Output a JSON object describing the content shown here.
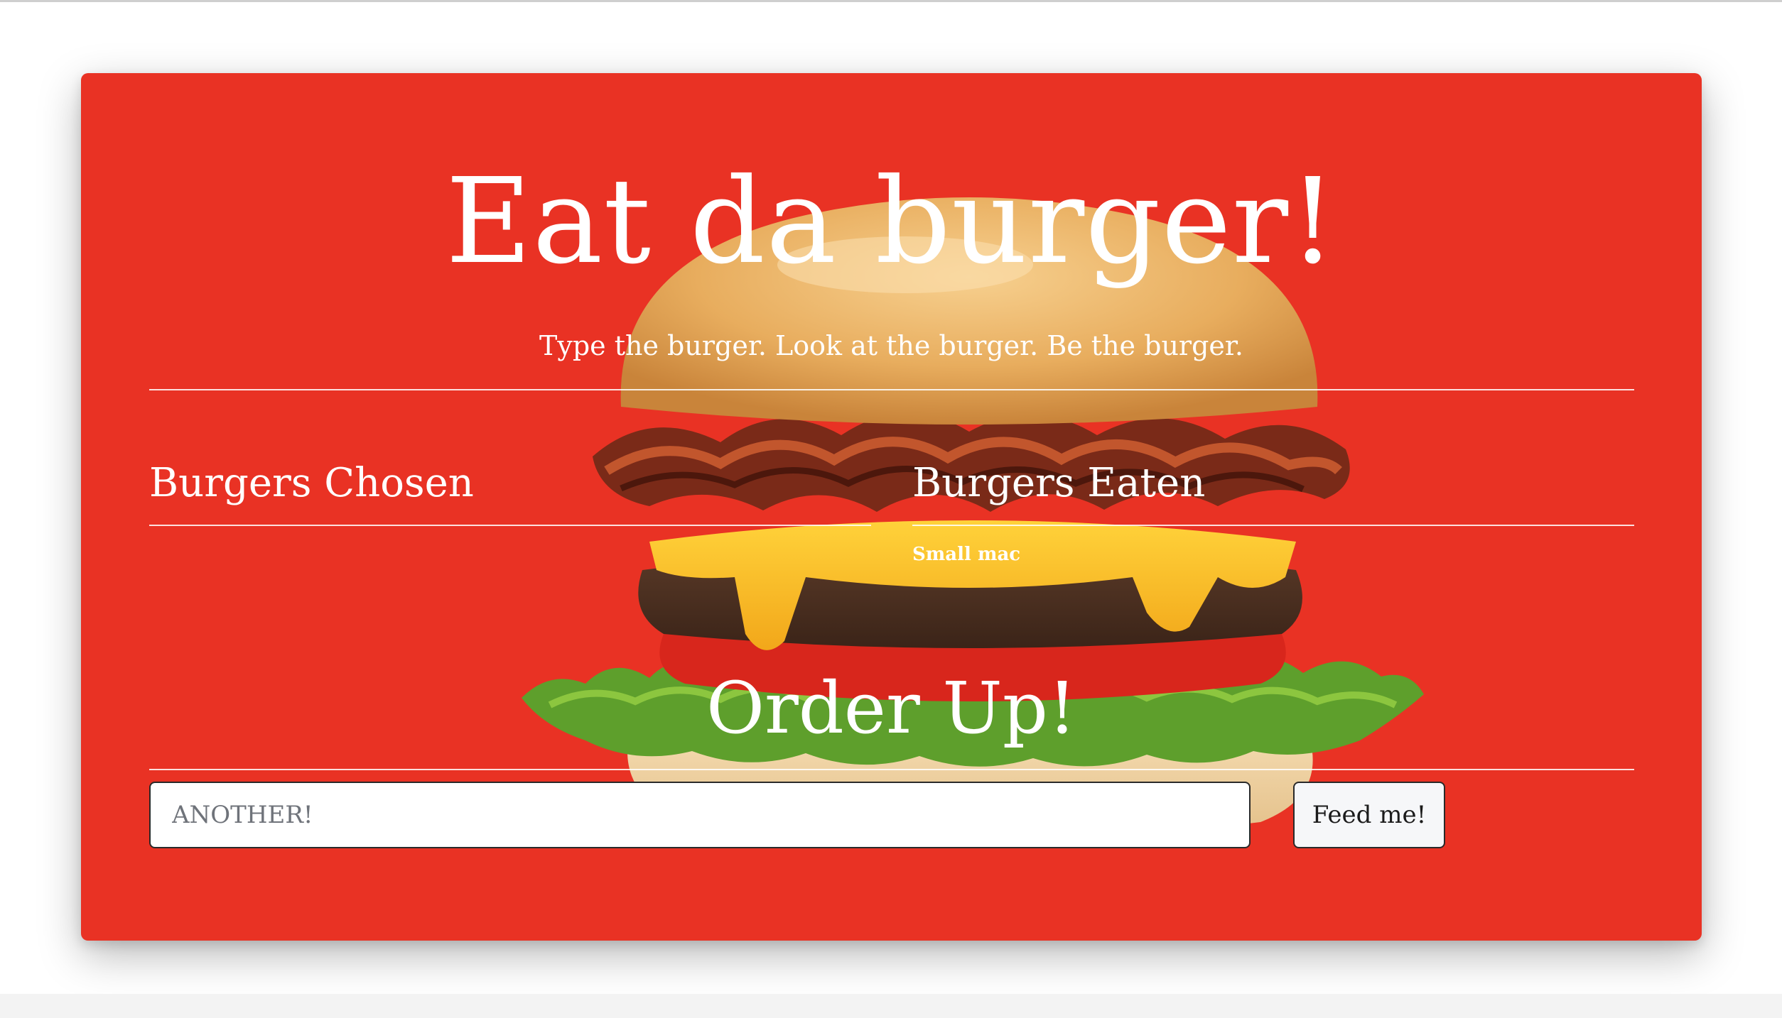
{
  "header": {
    "title": "Eat da burger!",
    "subtitle": "Type the burger. Look at the burger. Be the burger."
  },
  "columns": {
    "chosen_heading": "Burgers Chosen",
    "eaten_heading": "Burgers Eaten",
    "chosen_items": [],
    "eaten_items": [
      "Small mac"
    ]
  },
  "order": {
    "heading": "Order Up!",
    "input_placeholder": "ANOTHER!",
    "input_value": "",
    "submit_label": "Feed me!"
  },
  "colors": {
    "jumbotron_background": "#e93224",
    "text": "#ffffff"
  },
  "images": {
    "background": "burger-photo"
  }
}
